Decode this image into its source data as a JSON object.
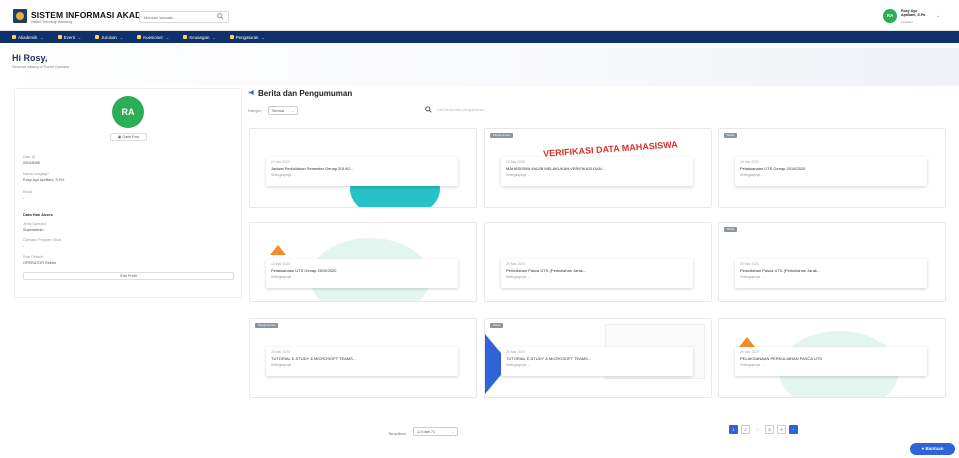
{
  "header": {
    "title": "SISTEM INFORMASI AKADEMIK",
    "subtitle": "Institut Teknologi Bandung",
    "search_placeholder": "Mencari sesuatu...",
    "user_initials": "RA",
    "user_name": "Rosy Ayu Apriliani, S.Pd",
    "user_role": "Operator"
  },
  "nav": {
    "items": [
      {
        "label": "Akademik"
      },
      {
        "label": "Event"
      },
      {
        "label": "Jurusan"
      },
      {
        "label": "Kuesioner"
      },
      {
        "label": "Keuangan"
      },
      {
        "label": "Pengaturan"
      }
    ]
  },
  "greeting": {
    "title": "Hi Rosy,",
    "subtitle": "Selamat datang di Portal Operator"
  },
  "profile": {
    "initials": "RA",
    "change_photo": "Ganti Foto",
    "user_id_label": "User ID",
    "user_id": "00048085",
    "full_name_label": "Nama Lengkap*",
    "full_name": "Rosy Ayu Apriliani, S.Pd.",
    "email_label": "Email",
    "email": "-",
    "access_heading": "Data Hak Akses",
    "operator_type_label": "Jenis Operator",
    "operator_type": "Superadmin",
    "prodi_label": "Operator Program Studi",
    "prodi": "-",
    "default_role_label": "Role Default",
    "default_role": "OPERATOR Rektor",
    "edit_button": "Edit Profil"
  },
  "news": {
    "title": "Berita dan Pengumuman",
    "filter_label": "Kategori",
    "filter_value": "Semua",
    "search_placeholder": "Cari berita atau pengumuman",
    "items": [
      {
        "tag": "",
        "date": "24 Jan 2020",
        "title": "Jadwal Perkuliahan Semester Genap 2019/2...",
        "more": "Selengkapnya →"
      },
      {
        "tag": "Pengumuman",
        "date": "10 Mar 2020",
        "title": "MAHASISWA WAJIB MELAKUKAN VERIFIKASI DAN...",
        "more": "Selengkapnya →"
      },
      {
        "tag": "Berita",
        "date": "16 Mar 2020",
        "title": "Pelaksanaan UTS Genap 2019/2020",
        "more": "Selengkapnya →"
      },
      {
        "tag": "",
        "date": "16 Mar 2020",
        "title": "Pelaksanaan UTS Genap 2019/2020",
        "more": "Selengkapnya →"
      },
      {
        "tag": "",
        "date": "25 Mar 2020",
        "title": "Perkuliahan Pasca UTS (Perkuliahan Jarak...",
        "more": "Selengkapnya →"
      },
      {
        "tag": "Berita",
        "date": "25 Mar 2020",
        "title": "Perkuliahan Pasca UTS (Perkuliahan Jarak...",
        "more": "Selengkapnya →"
      },
      {
        "tag": "Pengumuman",
        "date": "26 Mar 2020",
        "title": "TUTORIAL E-STUDY &amp; MICROSOFT TEAMS...",
        "more": "Selengkapnya →"
      },
      {
        "tag": "Berita",
        "date": "26 Mar 2020",
        "title": "TUTORIAL E-STUDY &amp; MICROSOFT TEAMS...",
        "more": "Selengkapnya →"
      },
      {
        "tag": "",
        "date": "26 Mar 2020",
        "title": "PELAKSANAAN PERKULIAHAN PASCA UTS",
        "more": "Selengkapnya →"
      }
    ],
    "card2_banner": "VERIFIKASI DATA MAHASISWA"
  },
  "pagination": {
    "label": "Tampilkan",
    "per_page": "1-9 dari 71",
    "pages": [
      "1",
      "2",
      "...",
      "8",
      "9"
    ],
    "next": "›"
  },
  "help_button": "Bantuan",
  "colors": {
    "nav_bg": "#10306b",
    "accent": "#2f64d8",
    "avatar": "#2cae57"
  }
}
